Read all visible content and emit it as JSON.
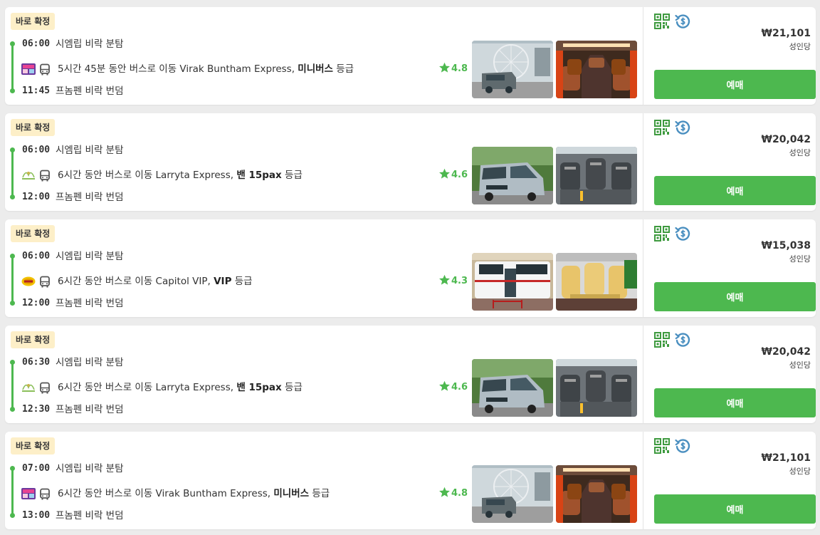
{
  "results": [
    {
      "badge": "바로 확정",
      "departure_time": "06:00",
      "departure_station": "시엠립 비락 분탐",
      "route_prefix": "5시간 45분 동안 버스로 이동 Virak Buntham Express, ",
      "class_name": "미니버스",
      "class_suffix": " 등급",
      "operator_logo": "virak-buntham-logo",
      "rating": "4.8",
      "arrival_time": "11:45",
      "arrival_station": "프놈펜 비락 번덤",
      "price": "₩21,101",
      "per_person": "성인당",
      "book_label": "예매",
      "photos": [
        "ferris-wheel-van-photo",
        "brown-seat-interior-photo"
      ]
    },
    {
      "badge": "바로 확정",
      "departure_time": "06:00",
      "departure_station": "시엠립 비락 분탐",
      "route_prefix": "6시간 동안 버스로 이동 Larryta Express, ",
      "class_name": "밴 15pax",
      "class_suffix": " 등급",
      "operator_logo": "larryta-logo",
      "rating": "4.6",
      "arrival_time": "12:00",
      "arrival_station": "프놈펜 비락 번덤",
      "price": "₩20,042",
      "per_person": "성인당",
      "book_label": "예매",
      "photos": [
        "silver-van-photo",
        "grey-seat-interior-photo"
      ]
    },
    {
      "badge": "바로 확정",
      "departure_time": "06:00",
      "departure_station": "시엠립 비락 분탐",
      "route_prefix": "6시간 동안 버스로 이동 Capitol VIP, ",
      "class_name": "VIP",
      "class_suffix": " 등급",
      "operator_logo": "capitol-logo",
      "rating": "4.3",
      "arrival_time": "12:00",
      "arrival_station": "프놈펜 비락 번덤",
      "price": "₩15,038",
      "per_person": "성인당",
      "book_label": "예매",
      "photos": [
        "white-van-open-door-photo",
        "yellow-seat-interior-photo"
      ]
    },
    {
      "badge": "바로 확정",
      "departure_time": "06:30",
      "departure_station": "시엠립 비락 분탐",
      "route_prefix": "6시간 동안 버스로 이동 Larryta Express, ",
      "class_name": "밴 15pax",
      "class_suffix": " 등급",
      "operator_logo": "larryta-logo",
      "rating": "4.6",
      "arrival_time": "12:30",
      "arrival_station": "프놈펜 비락 번덤",
      "price": "₩20,042",
      "per_person": "성인당",
      "book_label": "예매",
      "photos": [
        "silver-van-photo",
        "grey-seat-interior-photo"
      ]
    },
    {
      "badge": "바로 확정",
      "departure_time": "07:00",
      "departure_station": "시엠립 비락 분탐",
      "route_prefix": "6시간 동안 버스로 이동 Virak Buntham Express, ",
      "class_name": "미니버스",
      "class_suffix": " 등급",
      "operator_logo": "virak-buntham-logo",
      "rating": "4.8",
      "arrival_time": "13:00",
      "arrival_station": "프놈펜 비락 번덤",
      "price": "₩21,101",
      "per_person": "성인당",
      "book_label": "예매",
      "photos": [
        "ferris-wheel-van-photo",
        "brown-seat-interior-photo"
      ]
    }
  ],
  "colors": {
    "accent_green": "#4db84f",
    "badge_bg": "#fdefc8",
    "refund_blue": "#4a8fc0",
    "page_bg": "#ececec"
  },
  "icons": {
    "transport": "bus-icon",
    "ticket": "qr-code-icon",
    "refund": "refund-icon",
    "rating": "star-icon"
  }
}
